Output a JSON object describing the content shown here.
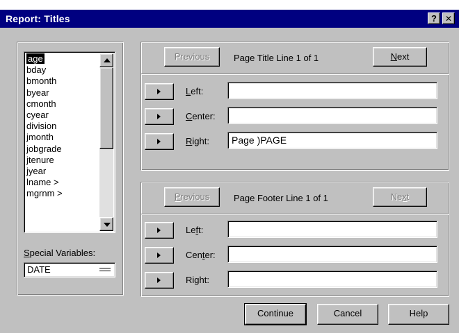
{
  "window": {
    "title": "Report: Titles",
    "help_label": "?",
    "close_label": "✕"
  },
  "variables": {
    "items": [
      {
        "label": "age",
        "selected": true
      },
      {
        "label": "bday"
      },
      {
        "label": "bmonth"
      },
      {
        "label": "byear"
      },
      {
        "label": "cmonth"
      },
      {
        "label": "cyear"
      },
      {
        "label": "division"
      },
      {
        "label": "jmonth"
      },
      {
        "label": "jobgrade"
      },
      {
        "label": "jtenure"
      },
      {
        "label": "jyear"
      },
      {
        "label": "lname  >"
      },
      {
        "label": "mgrnm  >"
      }
    ],
    "special_label_u": "S",
    "special_label_rest": "pecial Variables:",
    "special_value": "DATE"
  },
  "title_section": {
    "previous_label_u": "",
    "previous_label": "Previous",
    "heading": "Page Title Line 1 of 1",
    "next_label_u": "N",
    "next_label_rest": "ext",
    "left_label_u": "L",
    "left_label_rest": "eft:",
    "left_value": "",
    "center_label_u": "C",
    "center_label_rest": "enter:",
    "center_value": "",
    "right_label_u": "R",
    "right_label_rest": "ight:",
    "right_value": "Page )PAGE"
  },
  "footer_section": {
    "previous_label_u": "P",
    "previous_label_rest": "revious",
    "heading": "Page Footer Line 1 of 1",
    "next_label_a": "Ne",
    "next_label_u": "x",
    "next_label_b": "t",
    "left_label_a": "Le",
    "left_label_u": "f",
    "left_label_b": "t:",
    "left_value": "",
    "center_label_a": "Cen",
    "center_label_u": "t",
    "center_label_b": "er:",
    "center_value": "",
    "right_label_a": "Ri",
    "right_label_u": "g",
    "right_label_b": "ht:",
    "right_value": ""
  },
  "actions": {
    "continue_label": "Continue",
    "cancel_label": "Cancel",
    "help_label": "Help"
  }
}
